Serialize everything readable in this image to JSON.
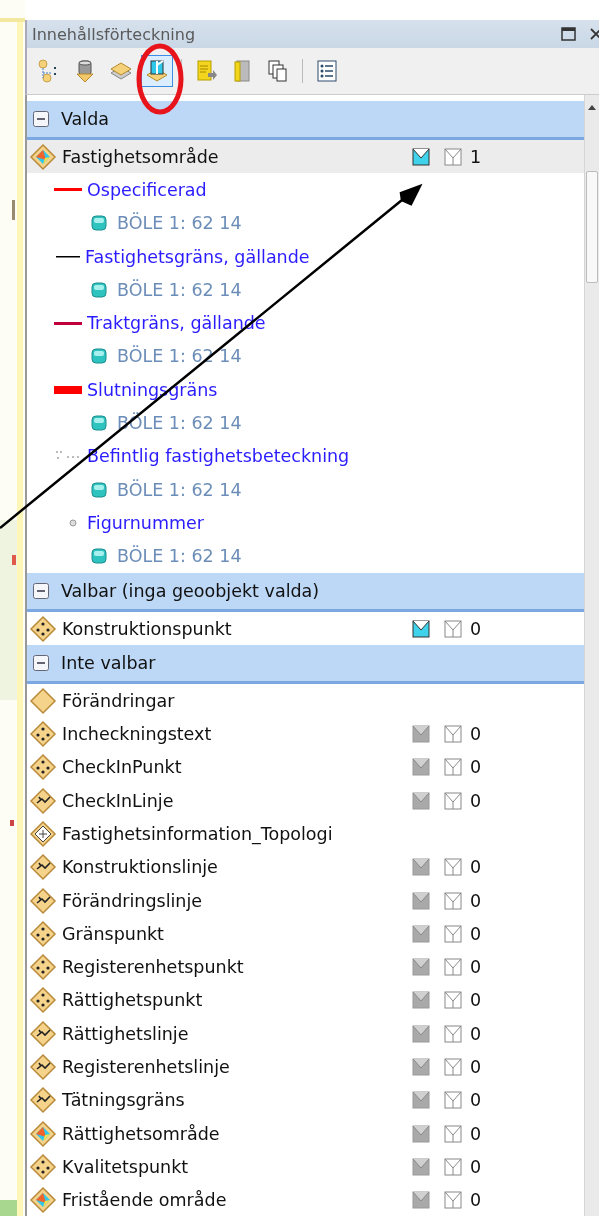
{
  "panel": {
    "title": "Innehållsförteckning"
  },
  "toolbar": [
    {
      "kind": "tree",
      "selected": false
    },
    {
      "kind": "database",
      "selected": false
    },
    {
      "kind": "layers",
      "selected": false
    },
    {
      "kind": "selectable",
      "selected": true
    },
    {
      "kind": "separator"
    },
    {
      "kind": "document",
      "selected": false
    },
    {
      "kind": "book",
      "selected": false
    },
    {
      "kind": "copies",
      "selected": false
    },
    {
      "kind": "separator"
    },
    {
      "kind": "list",
      "selected": false
    }
  ],
  "groups": [
    {
      "title": "Valda",
      "expanded": true,
      "layers": [
        {
          "name": "Fastighetsområde",
          "kind": "area",
          "selected": true,
          "selectable": true,
          "count": "1",
          "children": [
            {
              "name": "Ospecificerad",
              "kind": "line",
              "color": "#ff0000",
              "children": [
                {
                  "name": "BÖLE 1: 62 14"
                }
              ]
            },
            {
              "name": "Fastighetsgräns, gällande",
              "kind": "thin-line",
              "color": "#000000",
              "children": [
                {
                  "name": "BÖLE 1: 62 14"
                }
              ]
            },
            {
              "name": "Traktgräns, gällande",
              "kind": "line",
              "color": "#c0003a",
              "children": [
                {
                  "name": "BÖLE 1: 62 14"
                }
              ]
            },
            {
              "name": "Slutningsgräns",
              "kind": "bar",
              "color": "#ff0000",
              "children": [
                {
                  "name": "BÖLE 1: 62 14"
                }
              ]
            },
            {
              "name": "Befintlig fastighetsbeteckning",
              "kind": "label",
              "children": [
                {
                  "name": "BÖLE 1: 62 14"
                }
              ]
            },
            {
              "name": "Figurnummer",
              "kind": "dot",
              "children": [
                {
                  "name": "BÖLE 1: 62 14"
                }
              ]
            }
          ]
        }
      ]
    },
    {
      "title": "Valbar (inga geoobjekt valda)",
      "expanded": true,
      "layers": [
        {
          "name": "Konstruktionspunkt",
          "kind": "point",
          "selected": false,
          "selectable": true,
          "count": "0"
        }
      ]
    },
    {
      "title": "Inte valbar",
      "expanded": true,
      "layers": [
        {
          "name": "Förändringar",
          "kind": "group",
          "selected": false
        },
        {
          "name": "Incheckningstext",
          "kind": "point",
          "selected": false,
          "selectable": false,
          "count": "0"
        },
        {
          "name": "CheckInPunkt",
          "kind": "point",
          "selected": false,
          "selectable": false,
          "count": "0"
        },
        {
          "name": "CheckInLinje",
          "kind": "polyline",
          "selected": false,
          "selectable": false,
          "count": "0"
        },
        {
          "name": "Fastighetsinformation_Topologi",
          "kind": "topology",
          "selected": false
        },
        {
          "name": "Konstruktionslinje",
          "kind": "polyline",
          "selected": false,
          "selectable": false,
          "count": "0"
        },
        {
          "name": "Förändringslinje",
          "kind": "polyline",
          "selected": false,
          "selectable": false,
          "count": "0"
        },
        {
          "name": "Gränspunkt",
          "kind": "point",
          "selected": false,
          "selectable": false,
          "count": "0"
        },
        {
          "name": "Registerenhetspunkt",
          "kind": "point",
          "selected": false,
          "selectable": false,
          "count": "0"
        },
        {
          "name": "Rättighetspunkt",
          "kind": "point",
          "selected": false,
          "selectable": false,
          "count": "0"
        },
        {
          "name": "Rättighetslinje",
          "kind": "polyline",
          "selected": false,
          "selectable": false,
          "count": "0"
        },
        {
          "name": "Registerenhetslinje",
          "kind": "polyline",
          "selected": false,
          "selectable": false,
          "count": "0"
        },
        {
          "name": "Tätningsgräns",
          "kind": "polyline",
          "selected": false,
          "selectable": false,
          "count": "0"
        },
        {
          "name": "Rättighetsområde",
          "kind": "area",
          "selected": false,
          "selectable": false,
          "count": "0"
        },
        {
          "name": "Kvalitetspunkt",
          "kind": "point",
          "selected": false,
          "selectable": false,
          "count": "0"
        },
        {
          "name": "Fristående område",
          "kind": "area",
          "selected": false,
          "selectable": false,
          "count": "0"
        }
      ]
    }
  ]
}
